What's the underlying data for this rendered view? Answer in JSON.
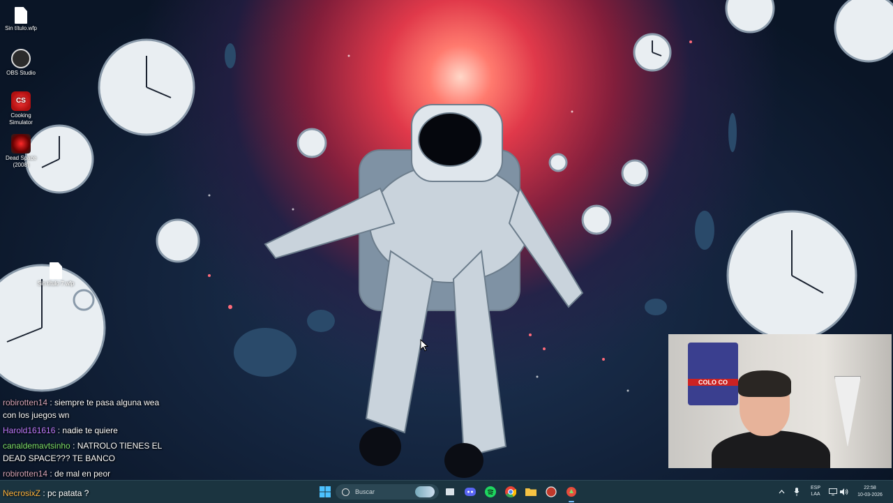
{
  "desktop": {
    "icons": [
      {
        "label": "Sin título.wfp",
        "icon": "document-icon"
      },
      {
        "label": "OBS Studio",
        "icon": "obs-icon"
      },
      {
        "label": "Cooking Simulator",
        "icon": "cooking-simulator-icon"
      },
      {
        "label": "Dead Space (2008)",
        "icon": "dead-space-icon"
      },
      {
        "label": "Sin título 7.wfp",
        "icon": "document-icon"
      }
    ],
    "wallpaper": "astronaut-in-clock-vortex"
  },
  "chat": {
    "messages": [
      {
        "user": "robirotten14",
        "color": "#d6a4b6",
        "text": ": siempre te pasa alguna wea con los juegos wn"
      },
      {
        "user": "Harold161616",
        "color": "#c07cff",
        "text": ": nadie te quiere"
      },
      {
        "user": "canaldemavtsinho",
        "color": "#7ee06a",
        "text": ": NATROLO TIENES EL DEAD SPACE??? TE BANCO"
      },
      {
        "user": "robirotten14",
        "color": "#d6a4b6",
        "text": ": de mal en peor"
      },
      {
        "user": "NecrosixZ",
        "color": "#ffb23a",
        "text": ": pc patata ?"
      }
    ]
  },
  "webcam": {
    "flag_text": "COLO CO"
  },
  "taskbar": {
    "search_placeholder": "Buscar",
    "apps": [
      "start-icon",
      "task-view-icon",
      "discord-icon",
      "spotify-icon",
      "chrome-icon",
      "file-explorer-icon",
      "game-icon",
      "cooking-simulator-icon"
    ],
    "lang_top": "ESP",
    "lang_bottom": "LAA",
    "time": "22:58",
    "date": "10-03-2026"
  },
  "colors": {
    "taskbar_bg": "#1b3440",
    "accent": "#79c0ff"
  }
}
